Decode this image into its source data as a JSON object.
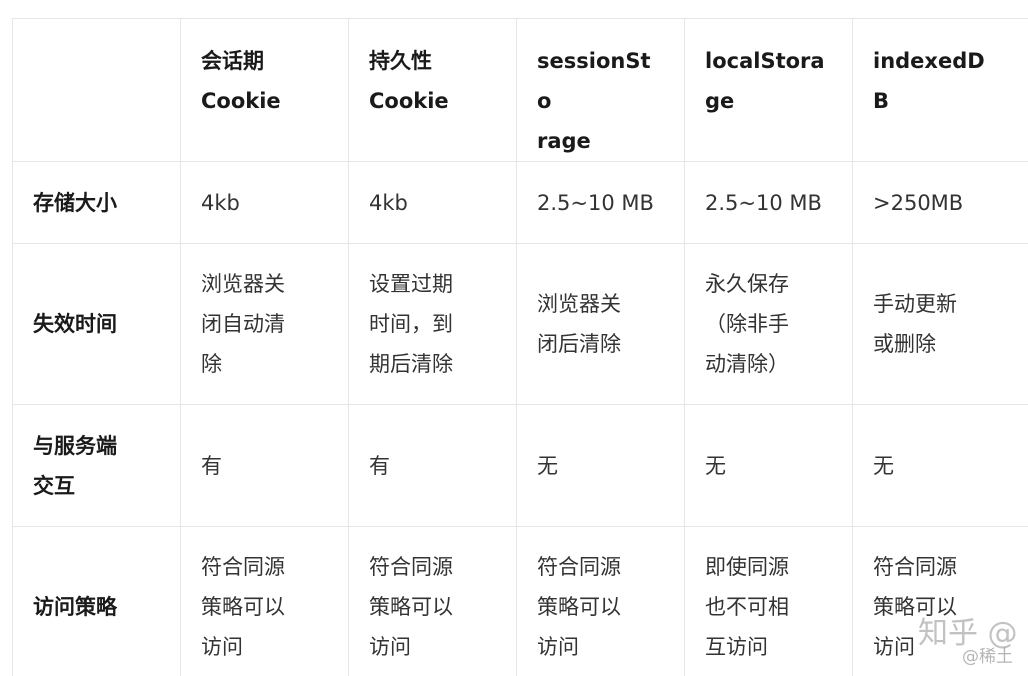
{
  "table": {
    "headers": [
      "",
      "会话期\nCookie",
      "持久性\nCookie",
      "sessionSto\nrage",
      "localStora\nge",
      "indexedD\nB"
    ],
    "rows": [
      {
        "label": "存储大小",
        "cells": [
          "4kb",
          "4kb",
          "2.5~10 MB",
          "2.5~10 MB",
          ">250MB"
        ]
      },
      {
        "label": "失效时间",
        "cells": [
          "浏览器关\n闭自动清\n除",
          "设置过期\n时间，到\n期后清除",
          "浏览器关\n闭后清除",
          "永久保存\n（除非手\n动清除）",
          "手动更新\n或删除"
        ]
      },
      {
        "label": "与服务端\n交互",
        "cells": [
          "有",
          "有",
          "无",
          "无",
          "无"
        ]
      },
      {
        "label": "访问策略",
        "cells": [
          "符合同源\n策略可以\n访问",
          "符合同源\n策略可以\n访问",
          "符合同源\n策略可以\n访问",
          "即使同源\n也不可相\n互访问",
          "符合同源\n策略可以\n访问"
        ]
      }
    ]
  },
  "watermark": {
    "main": "知乎 @",
    "sub": "@稀土"
  }
}
